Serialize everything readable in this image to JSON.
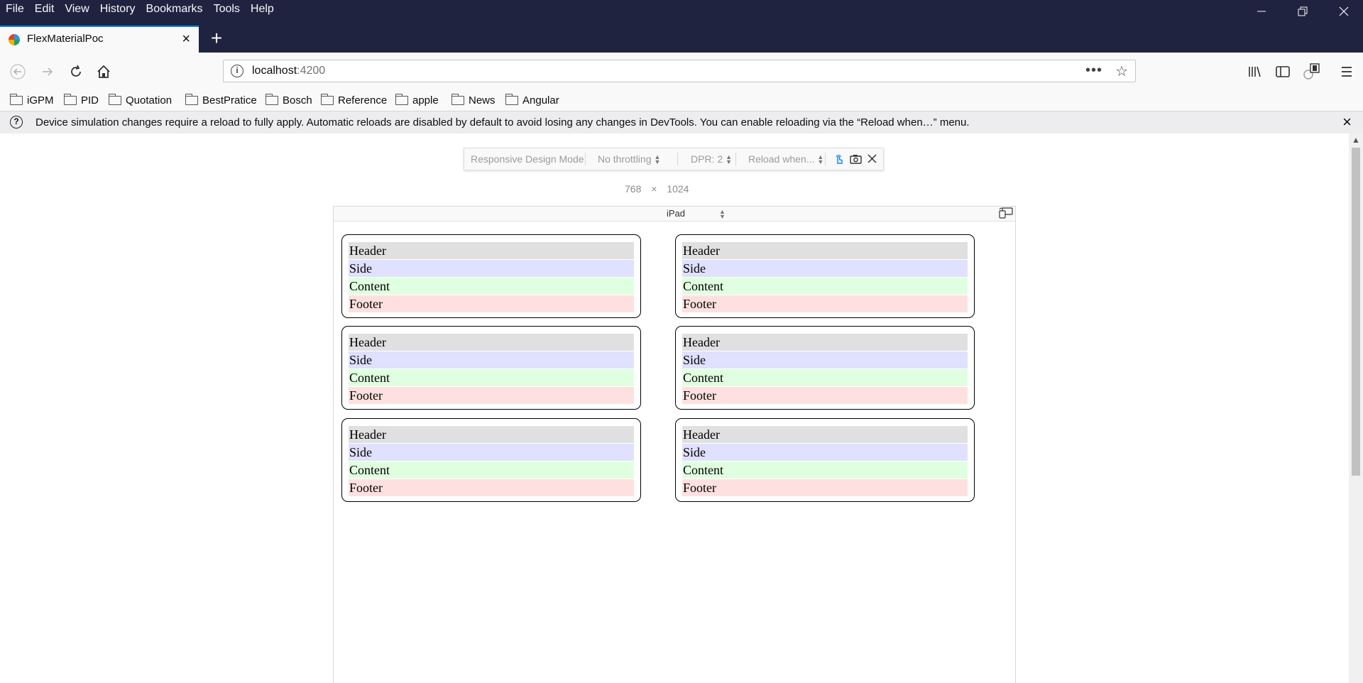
{
  "menubar": {
    "items": [
      "File",
      "Edit",
      "View",
      "History",
      "Bookmarks",
      "Tools",
      "Help"
    ]
  },
  "tab": {
    "title": "FlexMaterialPoc"
  },
  "url": {
    "host": "localhost",
    "port": ":4200"
  },
  "bookmarks": [
    "iGPM",
    "PID",
    "Quotation",
    "BestPratice",
    "Bosch",
    "Reference",
    "apple",
    "News",
    "Angular"
  ],
  "notification": {
    "message": "Device simulation changes require a reload to fully apply. Automatic reloads are disabled by default to avoid losing any changes in DevTools. You can enable reloading via the “Reload when…” menu."
  },
  "rdm": {
    "mode_label": "Responsive Design Mode",
    "throttling": "No throttling",
    "dpr": "DPR: 2",
    "reload": "Reload when...",
    "width": "768",
    "times": "×",
    "height": "1024",
    "device": "iPad"
  },
  "cards": [
    {
      "header": "Header",
      "side": "Side",
      "content": "Content",
      "footer": "Footer"
    },
    {
      "header": "Header",
      "side": "Side",
      "content": "Content",
      "footer": "Footer"
    },
    {
      "header": "Header",
      "side": "Side",
      "content": "Content",
      "footer": "Footer"
    },
    {
      "header": "Header",
      "side": "Side",
      "content": "Content",
      "footer": "Footer"
    },
    {
      "header": "Header",
      "side": "Side",
      "content": "Content",
      "footer": "Footer"
    },
    {
      "header": "Header",
      "side": "Side",
      "content": "Content",
      "footer": "Footer"
    }
  ],
  "colors": {
    "chrome_dark": "#202340",
    "accent": "#0a84ff",
    "header_row": "#e0e0e0",
    "side_row": "#e0e0ff",
    "content_row": "#e0ffe0",
    "footer_row": "#ffe0e0"
  },
  "icons": {
    "back": "arrow-left-icon",
    "forward": "arrow-right-icon",
    "reload": "reload-icon",
    "home": "home-icon",
    "library": "library-icon",
    "sidebar": "sidebar-icon",
    "extension": "extension-icon",
    "menu": "hamburger-icon"
  }
}
